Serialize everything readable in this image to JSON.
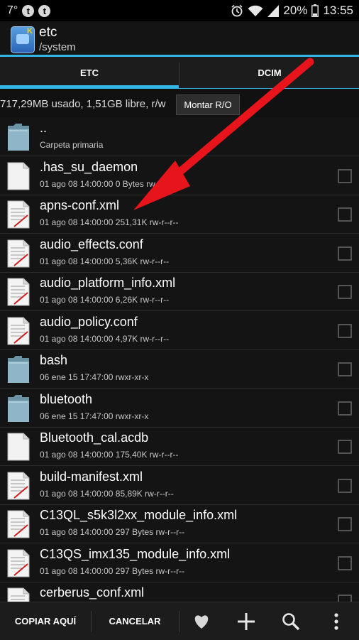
{
  "status": {
    "temp": "7°",
    "battery": "20%",
    "time": "13:55"
  },
  "header": {
    "title": "etc",
    "path": "/system"
  },
  "tabs": [
    {
      "label": "ETC"
    },
    {
      "label": "DCIM"
    }
  ],
  "storage": {
    "info": "717,29MB usado, 1,51GB libre, r/w",
    "mount_label": "Montar R/O"
  },
  "files": [
    {
      "name": "..",
      "meta": "Carpeta primaria",
      "type": "folder"
    },
    {
      "name": ".has_su_daemon",
      "meta": "01 ago 08 14:00:00  0 Bytes  rw-r--r--",
      "type": "file"
    },
    {
      "name": "apns-conf.xml",
      "meta": "01 ago 08 14:00:00  251,31K  rw-r--r--",
      "type": "xml"
    },
    {
      "name": "audio_effects.conf",
      "meta": "01 ago 08 14:00:00  5,36K  rw-r--r--",
      "type": "xml"
    },
    {
      "name": "audio_platform_info.xml",
      "meta": "01 ago 08 14:00:00  6,26K  rw-r--r--",
      "type": "xml"
    },
    {
      "name": "audio_policy.conf",
      "meta": "01 ago 08 14:00:00  4,97K  rw-r--r--",
      "type": "xml"
    },
    {
      "name": "bash",
      "meta": "06 ene 15 17:47:00     rwxr-xr-x",
      "type": "folder"
    },
    {
      "name": "bluetooth",
      "meta": "06 ene 15 17:47:00     rwxr-xr-x",
      "type": "folder"
    },
    {
      "name": "Bluetooth_cal.acdb",
      "meta": "01 ago 08 14:00:00  175,40K  rw-r--r--",
      "type": "file"
    },
    {
      "name": "build-manifest.xml",
      "meta": "01 ago 08 14:00:00  85,89K  rw-r--r--",
      "type": "xml"
    },
    {
      "name": "C13QL_s5k3l2xx_module_info.xml",
      "meta": "01 ago 08 14:00:00  297 Bytes  rw-r--r--",
      "type": "xml"
    },
    {
      "name": "C13QS_imx135_module_info.xml",
      "meta": "01 ago 08 14:00:00  297 Bytes  rw-r--r--",
      "type": "xml"
    },
    {
      "name": "cerberus_conf.xml",
      "meta": "",
      "type": "xml"
    }
  ],
  "bottom": {
    "copy_label": "COPIAR AQUÍ",
    "cancel_label": "CANCELAR"
  },
  "colors": {
    "accent": "#33b5e5",
    "arrow": "#e8141c"
  }
}
